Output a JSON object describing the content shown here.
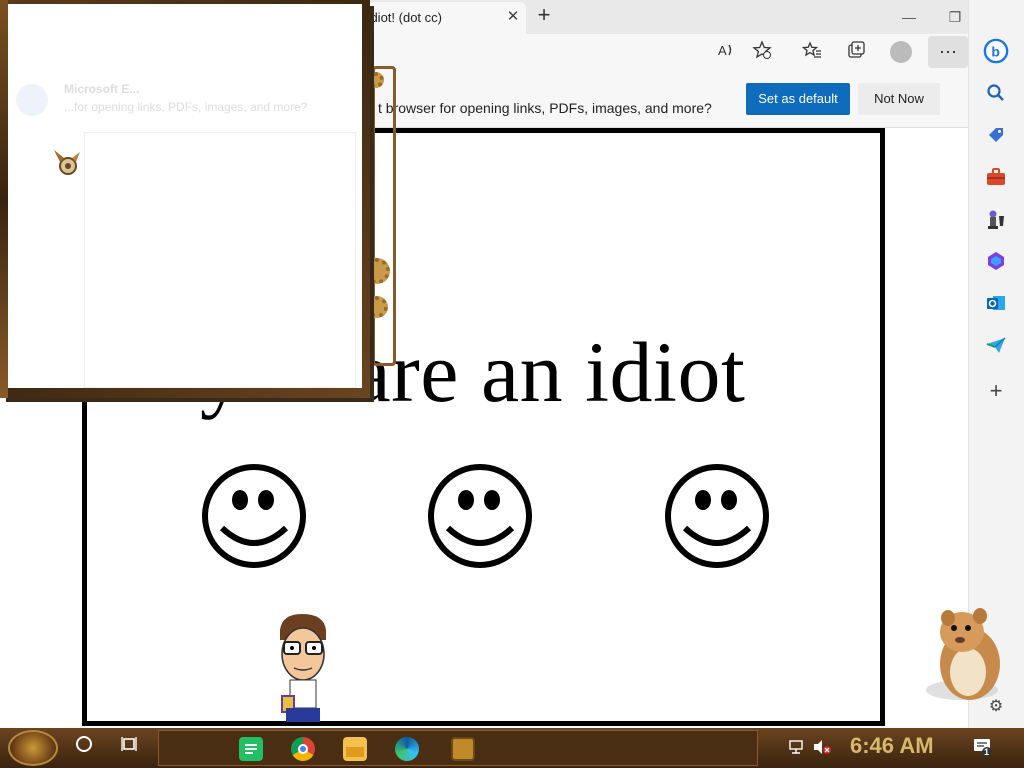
{
  "browser": {
    "tab_title": "n Idiot! (dot cc)",
    "tab_close": "✕",
    "new_tab": "+",
    "win_min": "—",
    "win_max": "❐",
    "win_close": "✕",
    "more_label": "···"
  },
  "infobar": {
    "text": "t browser for opening links, PDFs, images, and more?",
    "set_default": "Set as default",
    "not_now": "Not Now"
  },
  "page": {
    "headline": "you are an idiot"
  },
  "popup": {
    "ghost_title": "Microsoft E...",
    "ghost_line": "...for opening links, PDFs, images, and more?"
  },
  "sidebar": {
    "add": "+"
  },
  "taskbar": {
    "clock": "6:46 AM",
    "notification_count": "1"
  },
  "colors": {
    "accent": "#0f6cbd",
    "taskbar": "#5a3a1c",
    "clock": "#d8b86a"
  }
}
